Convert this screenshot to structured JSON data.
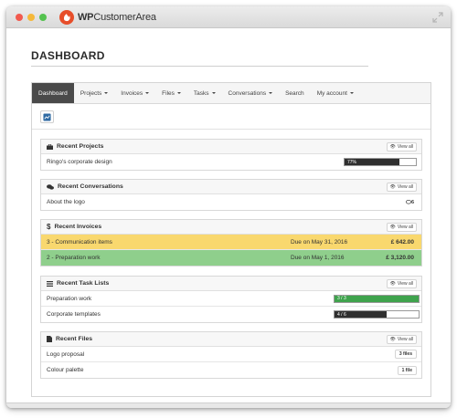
{
  "window": {
    "brand_prefix": "WP",
    "brand_suffix": "CustomerArea"
  },
  "page": {
    "title": "DASHBOARD"
  },
  "nav": {
    "items": [
      {
        "label": "Dashboard",
        "active": true,
        "dropdown": false
      },
      {
        "label": "Projects",
        "active": false,
        "dropdown": true
      },
      {
        "label": "Invoices",
        "active": false,
        "dropdown": true
      },
      {
        "label": "Files",
        "active": false,
        "dropdown": true
      },
      {
        "label": "Tasks",
        "active": false,
        "dropdown": true
      },
      {
        "label": "Conversations",
        "active": false,
        "dropdown": true
      },
      {
        "label": "Search",
        "active": false,
        "dropdown": false
      },
      {
        "label": "My account",
        "active": false,
        "dropdown": true
      }
    ]
  },
  "view_all_label": "View all",
  "projects": {
    "title": "Recent Projects",
    "rows": [
      {
        "name": "Ringo's corporate design",
        "progress": 77,
        "progress_label": "77%"
      }
    ]
  },
  "conversations": {
    "title": "Recent Conversations",
    "rows": [
      {
        "name": "About the logo",
        "count": "6"
      }
    ]
  },
  "invoices": {
    "title": "Recent Invoices",
    "rows": [
      {
        "name": "3 - Communication items",
        "due": "Due on May 31, 2016",
        "amount": "£ 642.00",
        "status_color": "#f9d86e"
      },
      {
        "name": "2 - Preparation work",
        "due": "Due on May 1, 2016",
        "amount": "£ 3,120.00",
        "status_color": "#8fcf8c"
      }
    ]
  },
  "tasks": {
    "title": "Recent Task Lists",
    "rows": [
      {
        "name": "Preparation work",
        "progress": 100,
        "progress_label": "3 / 3",
        "bar_color": "#3fa34d"
      },
      {
        "name": "Corporate templates",
        "progress": 62,
        "progress_label": "4 / 6",
        "bar_color": "#2f2f2f"
      }
    ]
  },
  "files": {
    "title": "Recent Files",
    "rows": [
      {
        "name": "Logo proposal",
        "count": "3 files"
      },
      {
        "name": "Colour palette",
        "count": "1 file"
      }
    ]
  },
  "colors": {
    "active_nav": "#4a4a4a",
    "brand": "#e74e2a",
    "progress_dark": "#2f2f2f",
    "progress_green": "#3fa34d"
  },
  "icons": {
    "projects": "briefcase-icon",
    "conversations": "comments-icon",
    "invoices": "dollar-icon",
    "tasks": "list-icon",
    "files": "file-icon",
    "view_all": "eye-icon",
    "toolbar": "dashboard-icon"
  }
}
